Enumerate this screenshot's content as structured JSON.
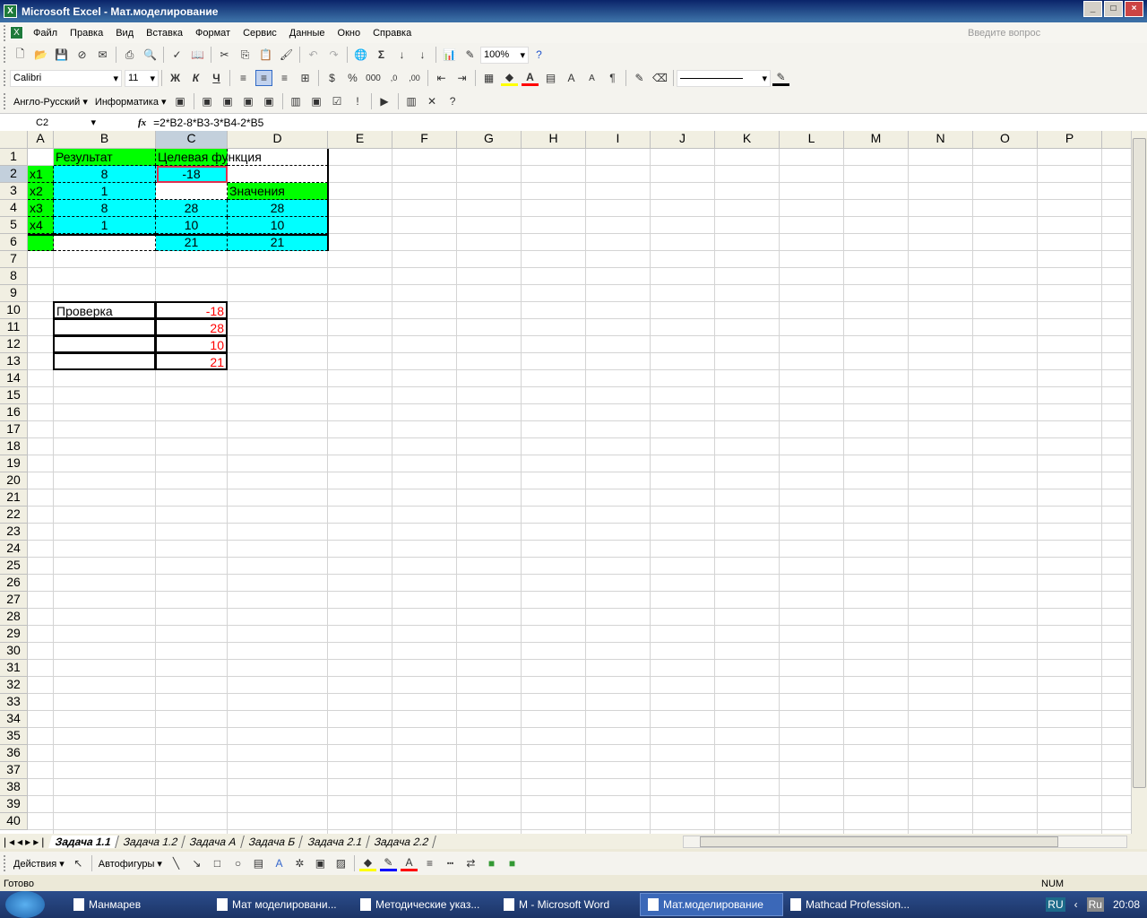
{
  "window": {
    "title": "Microsoft Excel - Мат.моделирование",
    "buttons": [
      "_",
      "□",
      "×"
    ]
  },
  "menu": {
    "items": [
      "Файл",
      "Правка",
      "Вид",
      "Вставка",
      "Формат",
      "Сервис",
      "Данные",
      "Окно",
      "Справка"
    ],
    "ask_placeholder": "Введите вопрос"
  },
  "toolbar": {
    "zoom": "100%",
    "font": "Calibri",
    "size": "11",
    "bold": "Ж",
    "italic": "К",
    "underline": "Ч",
    "percent": "%",
    "thousands": "000",
    "sigma": "Σ"
  },
  "toolbar3": {
    "items": [
      "Англо-Русский",
      "Информатика"
    ]
  },
  "formula": {
    "name_box": "C2",
    "fx": "fx",
    "value": "=2*B2-8*B3-3*B4-2*B5"
  },
  "grid": {
    "columns": [
      "A",
      "B",
      "C",
      "D",
      "E",
      "F",
      "G",
      "H",
      "I",
      "J",
      "K",
      "L",
      "M",
      "N",
      "O",
      "P"
    ],
    "row_count": 40,
    "selected_cell": "C2",
    "colors": {
      "green": "#00ff00",
      "cyan": "#00ffff",
      "red_text": "#ff0000"
    },
    "cells": [
      {
        "ref": "B1",
        "value": "Результат",
        "fill": "#00ff00"
      },
      {
        "ref": "C1",
        "value": "Целевая функция",
        "fill": "#00ff00"
      },
      {
        "ref": "A2",
        "value": "x1",
        "fill": "#00ff00"
      },
      {
        "ref": "B2",
        "value": "8",
        "fill": "#00ffff",
        "align": "center"
      },
      {
        "ref": "C2",
        "value": "-18",
        "fill": "#00ffff",
        "align": "center"
      },
      {
        "ref": "A3",
        "value": "x2",
        "fill": "#00ff00"
      },
      {
        "ref": "B3",
        "value": "1",
        "fill": "#00ffff",
        "align": "center"
      },
      {
        "ref": "D3",
        "value": "Значения",
        "fill": "#00ff00"
      },
      {
        "ref": "A4",
        "value": "x3",
        "fill": "#00ff00"
      },
      {
        "ref": "B4",
        "value": "8",
        "fill": "#00ffff",
        "align": "center"
      },
      {
        "ref": "C4",
        "value": "28",
        "fill": "#00ffff",
        "align": "center"
      },
      {
        "ref": "D4",
        "value": "28",
        "fill": "#00ffff",
        "align": "center"
      },
      {
        "ref": "A5",
        "value": "x4",
        "fill": "#00ff00"
      },
      {
        "ref": "B5",
        "value": "1",
        "fill": "#00ffff",
        "align": "center"
      },
      {
        "ref": "C5",
        "value": "10",
        "fill": "#00ffff",
        "align": "center"
      },
      {
        "ref": "D5",
        "value": "10",
        "fill": "#00ffff",
        "align": "center"
      },
      {
        "ref": "A6",
        "value": "",
        "fill": "#00ff00"
      },
      {
        "ref": "C6",
        "value": "21",
        "fill": "#00ffff",
        "align": "center"
      },
      {
        "ref": "D6",
        "value": "21",
        "fill": "#00ffff",
        "align": "center"
      },
      {
        "ref": "B10",
        "value": "Проверка",
        "box": true
      },
      {
        "ref": "C10",
        "value": "-18",
        "color": "#ff0000",
        "align": "right",
        "box": true
      },
      {
        "ref": "B11",
        "value": "",
        "box": true
      },
      {
        "ref": "C11",
        "value": "28",
        "color": "#ff0000",
        "align": "right",
        "box": true
      },
      {
        "ref": "B12",
        "value": "",
        "box": true
      },
      {
        "ref": "C12",
        "value": "10",
        "color": "#ff0000",
        "align": "right",
        "box": true
      },
      {
        "ref": "B13",
        "value": "",
        "box": true
      },
      {
        "ref": "C13",
        "value": "21",
        "color": "#ff0000",
        "align": "right",
        "box": true
      }
    ]
  },
  "sheets": {
    "tabs": [
      "Задача 1.1",
      "Задача 1.2",
      "Задача А",
      "Задача Б",
      "Задача 2.1",
      "Задача 2.2"
    ],
    "active": 0
  },
  "drawing": {
    "actions": "Действия",
    "autoshapes": "Автофигуры"
  },
  "status": {
    "left": "Готово",
    "num": "NUM"
  },
  "taskbar": {
    "items": [
      "Манмарев",
      "Мат моделировани...",
      "Методические указ...",
      "M - Microsoft Word",
      "Мат.моделирование",
      "Mathcad Profession..."
    ],
    "active": 4,
    "lang": "RU",
    "lang2": "Ru",
    "clock": "20:08"
  }
}
